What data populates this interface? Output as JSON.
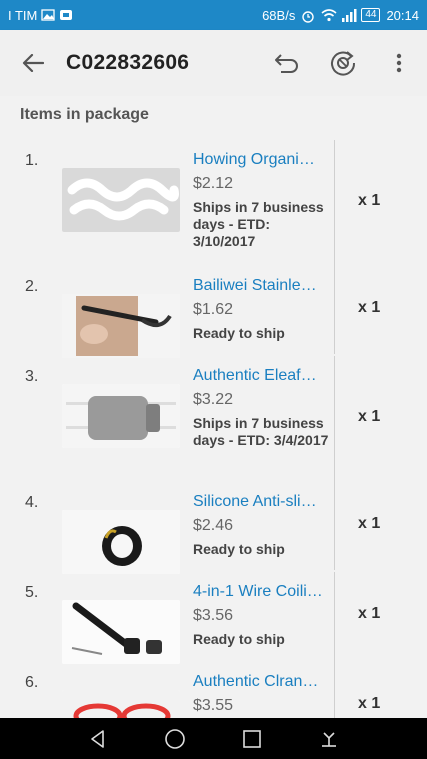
{
  "status": {
    "carrier": "I TIM",
    "speed": "68B/s",
    "battery": "44",
    "time": "20:14"
  },
  "header": {
    "title": "C022832606"
  },
  "section_title": "Items in package",
  "items": [
    {
      "num": "1.",
      "name": "Howing Organi…",
      "price": "$2.12",
      "ship": "Ships in 7 business days - ETD: 3/10/2017",
      "qty": "x 1"
    },
    {
      "num": "2.",
      "name": "Bailiwei Stainle…",
      "price": "$1.62",
      "ship": "Ready to ship",
      "qty": "x 1"
    },
    {
      "num": "3.",
      "name": "Authentic Eleaf…",
      "price": "$3.22",
      "ship": "Ships in 7 business days - ETD: 3/4/2017",
      "qty": "x 1"
    },
    {
      "num": "4.",
      "name": "Silicone Anti-sli…",
      "price": "$2.46",
      "ship": "Ready to ship",
      "qty": "x 1"
    },
    {
      "num": "5.",
      "name": "4-in-1 Wire Coili…",
      "price": "$3.56",
      "ship": "Ready to ship",
      "qty": "x 1"
    },
    {
      "num": "6.",
      "name": "Authentic Clran…",
      "price": "$3.55",
      "ship": "",
      "qty": "x 1"
    }
  ],
  "colors": {
    "status_bar": "#1e88c7",
    "link": "#1a7fc0"
  }
}
